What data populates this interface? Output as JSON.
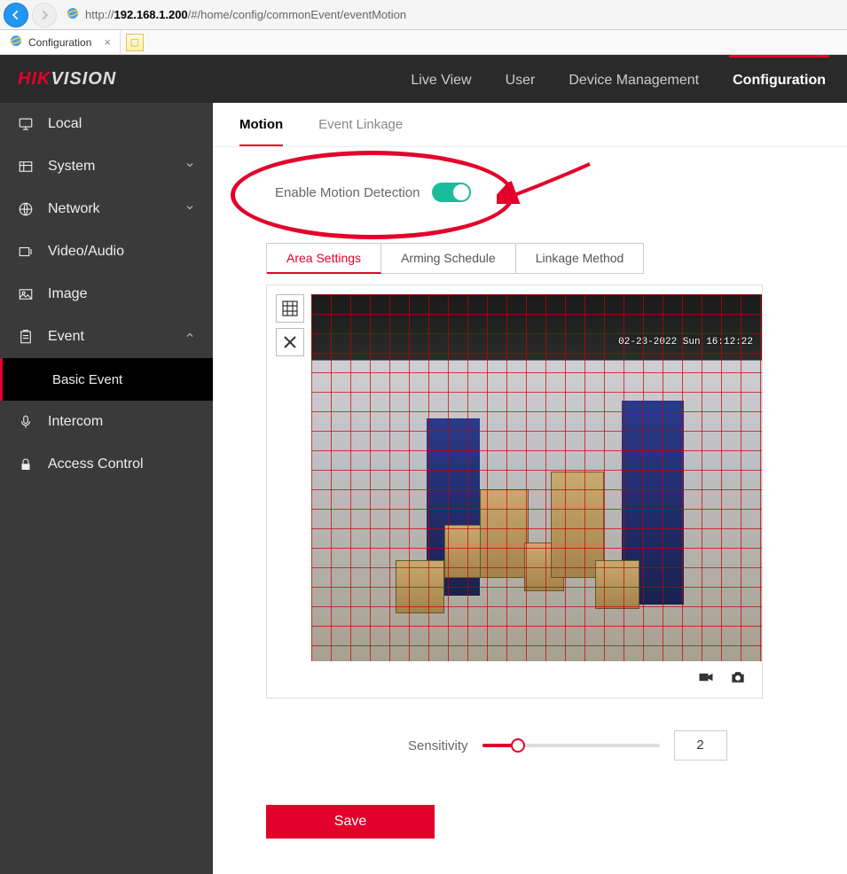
{
  "browser": {
    "url_prefix": "http://",
    "url_bold": "192.168.1.200",
    "url_rest": "/#/home/config/commonEvent/eventMotion",
    "tab_title": "Configuration"
  },
  "logo": {
    "red": "HIK",
    "white": "VISION"
  },
  "topnav": {
    "items": [
      {
        "label": "Live View"
      },
      {
        "label": "User"
      },
      {
        "label": "Device Management"
      },
      {
        "label": "Configuration",
        "active": true
      }
    ]
  },
  "sidebar": {
    "items": [
      {
        "label": "Local",
        "icon": "monitor"
      },
      {
        "label": "System",
        "icon": "grid",
        "expandable": true,
        "expanded": false
      },
      {
        "label": "Network",
        "icon": "globe",
        "expandable": true,
        "expanded": false
      },
      {
        "label": "Video/Audio",
        "icon": "display"
      },
      {
        "label": "Image",
        "icon": "image"
      },
      {
        "label": "Event",
        "icon": "clipboard",
        "expandable": true,
        "expanded": true,
        "children": [
          {
            "label": "Basic Event",
            "active": true
          }
        ]
      },
      {
        "label": "Intercom",
        "icon": "mic"
      },
      {
        "label": "Access Control",
        "icon": "lock"
      }
    ]
  },
  "tabs": {
    "items": [
      {
        "label": "Motion",
        "active": true
      },
      {
        "label": "Event Linkage"
      }
    ]
  },
  "motion": {
    "toggle_label": "Enable Motion Detection",
    "toggle_on": true
  },
  "subtabs": {
    "items": [
      {
        "label": "Area Settings",
        "active": true
      },
      {
        "label": "Arming Schedule"
      },
      {
        "label": "Linkage Method"
      }
    ]
  },
  "preview": {
    "timestamp": "02-23-2022 Sun 16:12:22"
  },
  "sensitivity": {
    "label": "Sensitivity",
    "value": "2"
  },
  "save_label": "Save",
  "annotation_colors": {
    "highlight": "#e3002b"
  }
}
